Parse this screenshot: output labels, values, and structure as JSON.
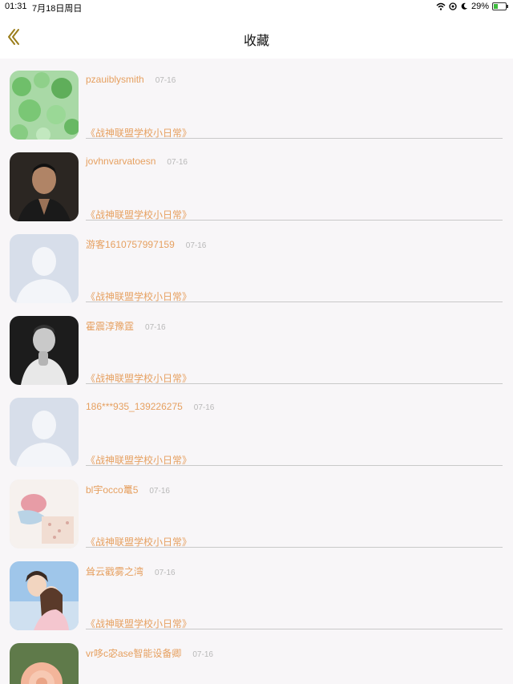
{
  "status_bar": {
    "time": "01:31",
    "date": "7月18日周日",
    "battery_percent": "29%",
    "icons": [
      "wifi-icon",
      "location-icon",
      "moon-icon",
      "battery-icon"
    ]
  },
  "nav": {
    "title": "收藏",
    "back_icon": "chevron-left-icon",
    "accent_color": "#9a7d1a"
  },
  "items": [
    {
      "username": "pzauiblysmith",
      "date": "07-16",
      "novel": "《战神联盟学校小日常》",
      "avatar": "clover-photo"
    },
    {
      "username": "jovhnvarvatoesn",
      "date": "07-16",
      "novel": "《战神联盟学校小日常》",
      "avatar": "man-portrait"
    },
    {
      "username": "游客1610757997159",
      "date": "07-16",
      "novel": "《战神联盟学校小日常》",
      "avatar": "default-avatar"
    },
    {
      "username": "霍震淳豫霆",
      "date": "07-16",
      "novel": "《战神联盟学校小日常》",
      "avatar": "man-bw-portrait"
    },
    {
      "username": "186***935_139226275",
      "date": "07-16",
      "novel": "《战神联盟学校小日常》",
      "avatar": "default-avatar"
    },
    {
      "username": "bl宇occo鼍5",
      "date": "07-16",
      "novel": "《战神联盟学校小日常》",
      "avatar": "illustration"
    },
    {
      "username": "耸云戳雾之湾",
      "date": "07-16",
      "novel": "《战神联盟学校小日常》",
      "avatar": "anime-couple"
    },
    {
      "username": "vr哆c宓ase智能设备卿",
      "date": "07-16",
      "novel": "",
      "avatar": "rose-photo"
    }
  ]
}
